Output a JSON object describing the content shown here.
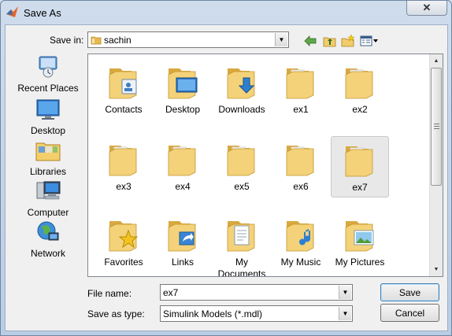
{
  "window": {
    "title": "Save As",
    "close_label": "✕"
  },
  "save_in": {
    "label": "Save in:",
    "value": "sachin"
  },
  "places": [
    {
      "label": "Recent Places",
      "icon": "recent-places-icon"
    },
    {
      "label": "Desktop",
      "icon": "desktop-icon"
    },
    {
      "label": "Libraries",
      "icon": "libraries-icon"
    },
    {
      "label": "Computer",
      "icon": "computer-icon"
    },
    {
      "label": "Network",
      "icon": "network-icon"
    }
  ],
  "files": [
    {
      "name": "Contacts",
      "overlay": "contacts"
    },
    {
      "name": "Desktop",
      "overlay": "desktop"
    },
    {
      "name": "Downloads",
      "overlay": "downloads"
    },
    {
      "name": "ex1",
      "overlay": ""
    },
    {
      "name": "ex2",
      "overlay": ""
    },
    {
      "name": "ex3",
      "overlay": ""
    },
    {
      "name": "ex4",
      "overlay": ""
    },
    {
      "name": "ex5",
      "overlay": ""
    },
    {
      "name": "ex6",
      "overlay": ""
    },
    {
      "name": "ex7",
      "overlay": "",
      "selected": true
    },
    {
      "name": "Favorites",
      "overlay": "favorites"
    },
    {
      "name": "Links",
      "overlay": "links"
    },
    {
      "name": "My Documents",
      "overlay": "documents"
    },
    {
      "name": "My Music",
      "overlay": "music"
    },
    {
      "name": "My Pictures",
      "overlay": "pictures"
    }
  ],
  "file_name": {
    "label": "File name:",
    "value": "ex7"
  },
  "save_as_type": {
    "label": "Save as type:",
    "value": "Simulink Models (*.mdl)"
  },
  "buttons": {
    "save": "Save",
    "cancel": "Cancel"
  },
  "colors": {
    "folder": "#f3d27a",
    "folder_dark": "#d9a93f",
    "selection": "#e8e8e8"
  }
}
